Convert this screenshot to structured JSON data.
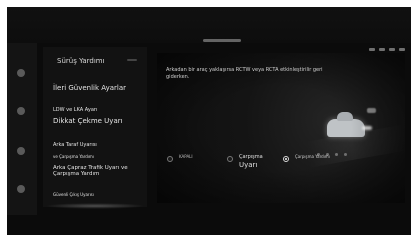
{
  "panel": {
    "title": "Sürüş Yardımı",
    "items": [
      "İleri Güvenlik Ayarlar",
      "LDW ve LKA Ayarı",
      "Dikkat Çekme Uyarı",
      "Arka Taraf Uyarısı",
      "ve Çarpışma Yardımı",
      "Arka Çapraz Trafik Uyarı ve Çarpışma Yardım",
      "Güvenli Çıkış Uyarısı"
    ]
  },
  "main": {
    "description": "Arkadan bir araç yaklaşırsa RCTW veya RCTA etkinleştirilir geri giderken.",
    "options": [
      {
        "label": "KAPALI",
        "selected": false
      },
      {
        "label_line1": "Çarpışma",
        "label_line2": "Uyarı",
        "selected": false
      },
      {
        "label": "Çarpışma Yardımı",
        "selected": true
      }
    ]
  },
  "colors": {
    "screen_bg": "#0b0b0b",
    "panel_bg": "#121212",
    "text_primary": "#e6e6e6"
  }
}
